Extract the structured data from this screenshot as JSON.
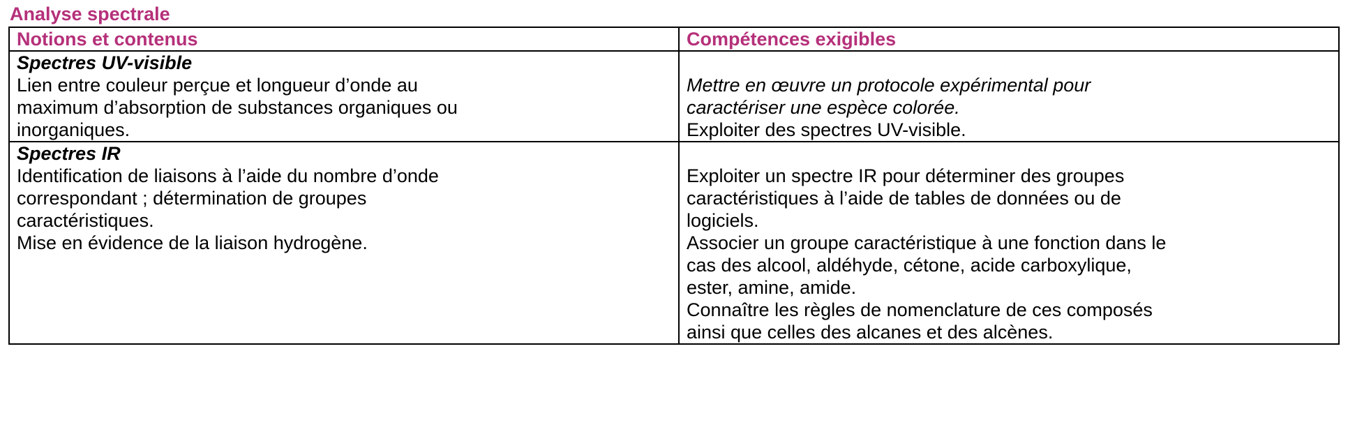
{
  "page": {
    "title": "Analyse spectrale",
    "accent_color": "#b5307a"
  },
  "table": {
    "headers": [
      "Notions et contenus",
      "Compétences exigibles"
    ],
    "rows": [
      {
        "section": "Spectres UV-visible",
        "notions": [
          "Lien entre couleur perçue et longueur d’onde au",
          "maximum d’absorption de substances organiques ou",
          "inorganiques."
        ],
        "competences_italic": [
          "Mettre en œuvre un protocole expérimental pour",
          "caractériser une espèce colorée."
        ],
        "competences": [
          "Exploiter des spectres UV-visible."
        ]
      },
      {
        "section": "Spectres IR",
        "notions": [
          "Identification de liaisons à l’aide du nombre d’onde",
          "correspondant ; détermination de groupes",
          "caractéristiques.",
          "Mise en évidence de la liaison hydrogène."
        ],
        "competences": [
          "Exploiter un spectre IR pour déterminer des groupes",
          "caractéristiques à l’aide de tables de données ou de",
          "logiciels.",
          "Associer un groupe caractéristique à une fonction dans le",
          "cas des alcool, aldéhyde, cétone, acide carboxylique,",
          "ester, amine, amide.",
          "Connaître les règles de nomenclature de ces composés",
          "ainsi que celles des alcanes et des alcènes."
        ]
      }
    ]
  }
}
